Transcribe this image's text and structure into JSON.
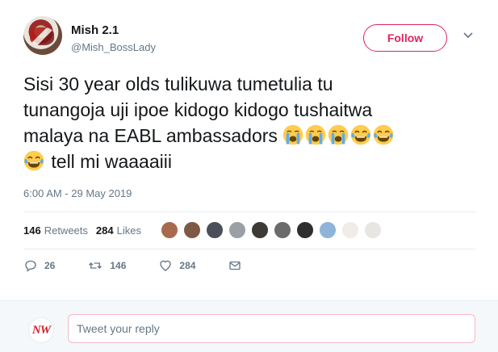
{
  "author": {
    "name": "Mish 2.1",
    "handle": "@Mish_BossLady"
  },
  "follow_label": "Follow",
  "tweet": {
    "line1": "Sisi 30 year olds tulikuwa tumetulia tu",
    "line2": "tunangoja uji ipoe kidogo kidogo tushaitwa",
    "line3": "malaya na EABL ambassadors",
    "line4": "tell mi waaaaiii",
    "emojis_line3": [
      "loudly-crying-face",
      "loudly-crying-face",
      "loudly-crying-face",
      "face-with-tears-of-joy",
      "face-with-tears-of-joy"
    ],
    "emojis_line4": [
      "face-with-tears-of-joy"
    ]
  },
  "timestamp": "6:00 AM - 29 May 2019",
  "stats": {
    "retweets_count": "146",
    "retweets_label": "Retweets",
    "likes_count": "284",
    "likes_label": "Likes"
  },
  "likers": [
    "#a86a4c",
    "#7e5a45",
    "#4a4f5a",
    "#9aa0a6",
    "#3d3a36",
    "#6b6b6b",
    "#2e2e2e",
    "#8fb3d9",
    "#f0ede8",
    "#e8e6e3"
  ],
  "actions": {
    "replies": "26",
    "retweets": "146",
    "likes": "284"
  },
  "reply": {
    "placeholder": "Tweet your reply",
    "avatar_text": "NW"
  },
  "colors": {
    "accent": "#e0245e",
    "secondary_text": "#657786"
  }
}
